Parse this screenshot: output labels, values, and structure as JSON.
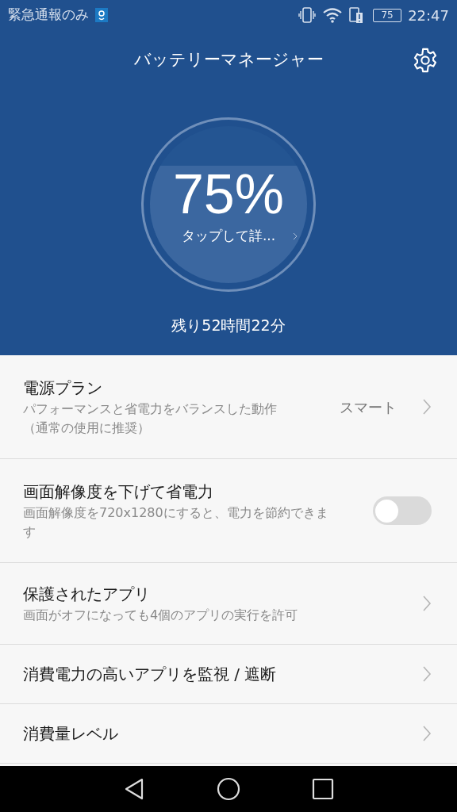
{
  "status_bar": {
    "carrier": "緊急通報のみ",
    "battery": "75",
    "time": "22:47"
  },
  "header": {
    "title": "バッテリーマネージャー"
  },
  "battery": {
    "percent": "75%",
    "detail": "タップして詳...",
    "remaining": "残り52時間22分"
  },
  "settings": [
    {
      "kind": "chevron",
      "title": "電源プラン",
      "subtitle": "パフォーマンスと省電力をバランスした動作（通常の使用に推奨）",
      "value": "スマート"
    },
    {
      "kind": "toggle",
      "title": "画面解像度を下げて省電力",
      "subtitle": "画面解像度を720x1280にすると、電力を節約できます",
      "on": false
    },
    {
      "kind": "chevron",
      "title": "保護されたアプリ",
      "subtitle": "画面がオフになっても4個のアプリの実行を許可"
    },
    {
      "kind": "chevron",
      "title": "消費電力の高いアプリを監視 / 遮断"
    },
    {
      "kind": "chevron",
      "title": "消費量レベル"
    }
  ]
}
